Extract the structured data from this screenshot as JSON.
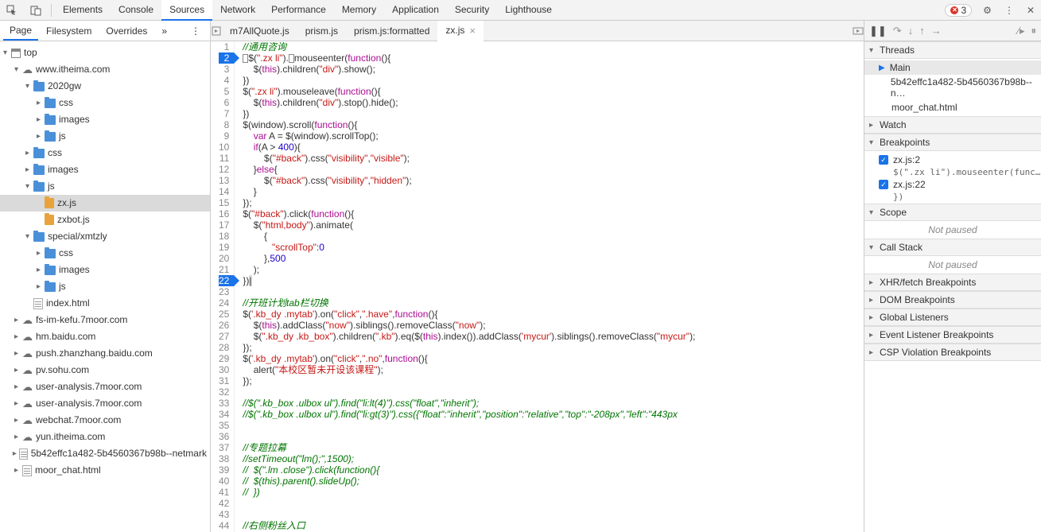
{
  "toolbar": {
    "tabs": [
      "Elements",
      "Console",
      "Sources",
      "Network",
      "Performance",
      "Memory",
      "Application",
      "Security",
      "Lighthouse"
    ],
    "active_tab": "Sources",
    "error_count": "3"
  },
  "left": {
    "subtabs": [
      "Page",
      "Filesystem",
      "Overrides"
    ],
    "active_subtab": "Page",
    "tree": [
      {
        "d": 0,
        "t": "top",
        "a": "down",
        "i": "window"
      },
      {
        "d": 1,
        "t": "www.itheima.com",
        "a": "down",
        "i": "cloud"
      },
      {
        "d": 2,
        "t": "2020gw",
        "a": "down",
        "i": "folder"
      },
      {
        "d": 3,
        "t": "css",
        "a": "right",
        "i": "folder"
      },
      {
        "d": 3,
        "t": "images",
        "a": "right",
        "i": "folder"
      },
      {
        "d": 3,
        "t": "js",
        "a": "right",
        "i": "folder"
      },
      {
        "d": 2,
        "t": "css",
        "a": "right",
        "i": "folder"
      },
      {
        "d": 2,
        "t": "images",
        "a": "right",
        "i": "folder"
      },
      {
        "d": 2,
        "t": "js",
        "a": "down",
        "i": "folder"
      },
      {
        "d": 3,
        "t": "zx.js",
        "a": "",
        "i": "jsfile",
        "sel": true
      },
      {
        "d": 3,
        "t": "zxbot.js",
        "a": "",
        "i": "jsfile"
      },
      {
        "d": 2,
        "t": "special/xmtzly",
        "a": "down",
        "i": "folder"
      },
      {
        "d": 3,
        "t": "css",
        "a": "right",
        "i": "folder"
      },
      {
        "d": 3,
        "t": "images",
        "a": "right",
        "i": "folder"
      },
      {
        "d": 3,
        "t": "js",
        "a": "right",
        "i": "folder"
      },
      {
        "d": 2,
        "t": "index.html",
        "a": "",
        "i": "htmlfile"
      },
      {
        "d": 1,
        "t": "fs-im-kefu.7moor.com",
        "a": "right",
        "i": "cloud"
      },
      {
        "d": 1,
        "t": "hm.baidu.com",
        "a": "right",
        "i": "cloud"
      },
      {
        "d": 1,
        "t": "push.zhanzhang.baidu.com",
        "a": "right",
        "i": "cloud"
      },
      {
        "d": 1,
        "t": "pv.sohu.com",
        "a": "right",
        "i": "cloud"
      },
      {
        "d": 1,
        "t": "user-analysis.7moor.com",
        "a": "right",
        "i": "cloud"
      },
      {
        "d": 1,
        "t": "user-analysis.7moor.com",
        "a": "right",
        "i": "cloud"
      },
      {
        "d": 1,
        "t": "webchat.7moor.com",
        "a": "right",
        "i": "cloud"
      },
      {
        "d": 1,
        "t": "yun.itheima.com",
        "a": "right",
        "i": "cloud"
      },
      {
        "d": 1,
        "t": "5b42effc1a482-5b4560367b98b--netmark",
        "a": "right",
        "i": "frame"
      },
      {
        "d": 1,
        "t": "moor_chat.html",
        "a": "right",
        "i": "frame"
      }
    ]
  },
  "editor": {
    "tabs": [
      "m7AllQuote.js",
      "prism.js",
      "prism.js:formatted",
      "zx.js"
    ],
    "active_tab": "zx.js",
    "breakpoint_lines": [
      2,
      22
    ],
    "code": [
      {
        "n": 1,
        "h": "<span class='tok-com'>//通用咨询</span>"
      },
      {
        "n": 2,
        "h": "<span class='cursor-box'></span>$(<span class='tok-str'>\".zx li\"</span>).<span class='cursor-box'></span>mouseenter(<span class='tok-kw'>function</span>(){"
      },
      {
        "n": 3,
        "h": "    $(<span class='tok-this'>this</span>).children(<span class='tok-str'>\"div\"</span>).show();"
      },
      {
        "n": 4,
        "h": "})"
      },
      {
        "n": 5,
        "h": "$(<span class='tok-str'>\".zx li\"</span>).mouseleave(<span class='tok-kw'>function</span>(){"
      },
      {
        "n": 6,
        "h": "    $(<span class='tok-this'>this</span>).children(<span class='tok-str'>\"div\"</span>).stop().hide();"
      },
      {
        "n": 7,
        "h": "})"
      },
      {
        "n": 8,
        "h": "$(window).scroll(<span class='tok-kw'>function</span>(){"
      },
      {
        "n": 9,
        "h": "    <span class='tok-kw'>var</span> A = $(window).scrollTop();"
      },
      {
        "n": 10,
        "h": "    <span class='tok-kw'>if</span>(A &gt; <span class='tok-num'>400</span>){"
      },
      {
        "n": 11,
        "h": "        $(<span class='tok-str'>\"#back\"</span>).css(<span class='tok-str'>\"visibility\"</span>,<span class='tok-str'>\"visible\"</span>);"
      },
      {
        "n": 12,
        "h": "    }<span class='tok-kw'>else</span>{"
      },
      {
        "n": 13,
        "h": "        $(<span class='tok-str'>\"#back\"</span>).css(<span class='tok-str'>\"visibility\"</span>,<span class='tok-str'>\"hidden\"</span>);"
      },
      {
        "n": 14,
        "h": "    }"
      },
      {
        "n": 15,
        "h": "});"
      },
      {
        "n": 16,
        "h": "$(<span class='tok-str'>\"#back\"</span>).click(<span class='tok-kw'>function</span>(){"
      },
      {
        "n": 17,
        "h": "    $(<span class='tok-str'>\"html,body\"</span>).animate("
      },
      {
        "n": 18,
        "h": "        {"
      },
      {
        "n": 19,
        "h": "           <span class='tok-str'>\"scrollTop\"</span>:<span class='tok-num'>0</span>"
      },
      {
        "n": 20,
        "h": "        },<span class='tok-num'>500</span>"
      },
      {
        "n": 21,
        "h": "    );"
      },
      {
        "n": 22,
        "h": "})<span style='background:#ddd;'>|</span>"
      },
      {
        "n": 23,
        "h": ""
      },
      {
        "n": 24,
        "h": "<span class='tok-com'>//开班计划tab栏切换</span>"
      },
      {
        "n": 25,
        "h": "$(<span class='tok-str'>'.kb_dy .mytab'</span>).on(<span class='tok-str'>\"click\"</span>,<span class='tok-str'>\".have\"</span>,<span class='tok-kw'>function</span>(){"
      },
      {
        "n": 26,
        "h": "    $(<span class='tok-this'>this</span>).addClass(<span class='tok-str'>\"now\"</span>).siblings().removeClass(<span class='tok-str'>\"now\"</span>);"
      },
      {
        "n": 27,
        "h": "    $(<span class='tok-str'>\".kb_dy .kb_box\"</span>).children(<span class='tok-str'>\".kb\"</span>).eq($(<span class='tok-this'>this</span>).index()).addClass(<span class='tok-str'>'mycur'</span>).siblings().removeClass(<span class='tok-str'>\"mycur\"</span>);"
      },
      {
        "n": 28,
        "h": "});"
      },
      {
        "n": 29,
        "h": "$(<span class='tok-str'>'.kb_dy .mytab'</span>).on(<span class='tok-str'>\"click\"</span>,<span class='tok-str'>\".no\"</span>,<span class='tok-kw'>function</span>(){"
      },
      {
        "n": 30,
        "h": "    alert(<span class='tok-str'>\"本校区暂未开设该课程\"</span>);"
      },
      {
        "n": 31,
        "h": "});"
      },
      {
        "n": 32,
        "h": ""
      },
      {
        "n": 33,
        "h": "<span class='tok-com'>//$(\".kb_box .ulbox ul\").find(\"li:lt(4)\").css(\"float\",\"inherit\");</span>"
      },
      {
        "n": 34,
        "h": "<span class='tok-com'>//$(\".kb_box .ulbox ul\").find(\"li:gt(3)\").css({\"float\":\"inherit\",\"position\":\"relative\",\"top\":\"-208px\",\"left\":\"443px</span>"
      },
      {
        "n": 35,
        "h": ""
      },
      {
        "n": 36,
        "h": ""
      },
      {
        "n": 37,
        "h": "<span class='tok-com'>//专题拉幕</span>"
      },
      {
        "n": 38,
        "h": "<span class='tok-com'>//setTimeout(\"lm();\",1500);</span>"
      },
      {
        "n": 39,
        "h": "<span class='tok-com'>//  $(\".lm .close\").click(function(){</span>"
      },
      {
        "n": 40,
        "h": "<span class='tok-com'>//  $(this).parent().slideUp();</span>"
      },
      {
        "n": 41,
        "h": "<span class='tok-com'>//  })</span>"
      },
      {
        "n": 42,
        "h": ""
      },
      {
        "n": 43,
        "h": ""
      },
      {
        "n": 44,
        "h": "<span class='tok-com'>//右侧粉丝入口</span>"
      }
    ]
  },
  "right": {
    "threads_label": "Threads",
    "threads": [
      {
        "t": "Main",
        "main": true
      },
      {
        "t": "5b42effc1a482-5b4560367b98b--n…"
      },
      {
        "t": "moor_chat.html"
      }
    ],
    "watch_label": "Watch",
    "breakpoints_label": "Breakpoints",
    "breakpoints": [
      {
        "t": "zx.js:2",
        "d": "$(\".zx li\").mouseenter(func…"
      },
      {
        "t": "zx.js:22",
        "d": "})"
      }
    ],
    "scope_label": "Scope",
    "not_paused": "Not paused",
    "callstack_label": "Call Stack",
    "xhr_label": "XHR/fetch Breakpoints",
    "dom_label": "DOM Breakpoints",
    "global_label": "Global Listeners",
    "event_label": "Event Listener Breakpoints",
    "csp_label": "CSP Violation Breakpoints"
  }
}
